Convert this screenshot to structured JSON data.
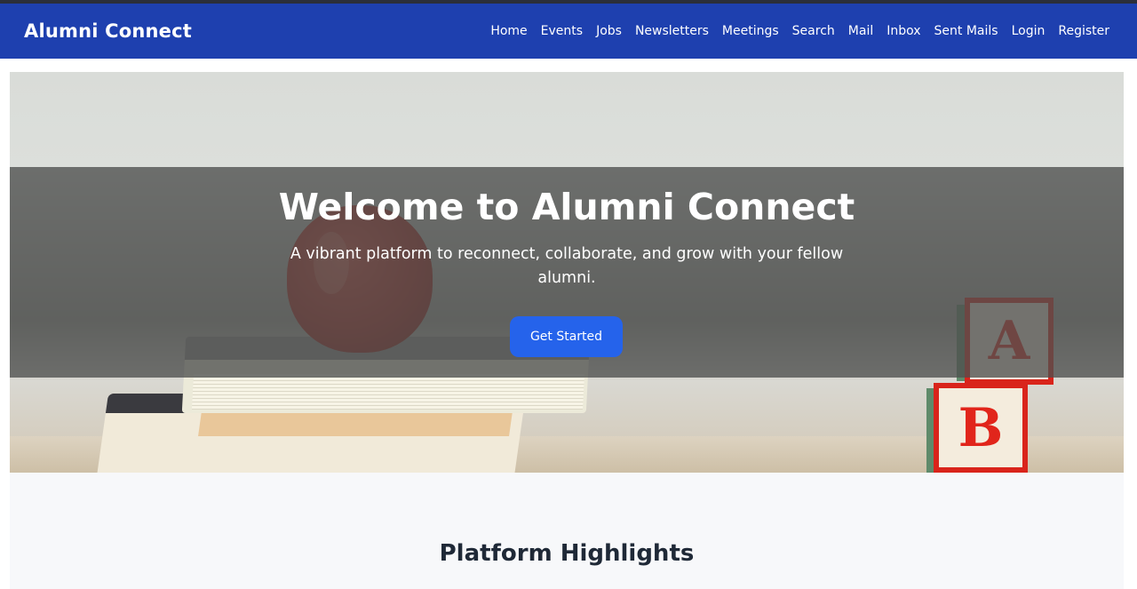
{
  "brand": {
    "name": "Alumni Connect"
  },
  "nav": {
    "items": [
      {
        "label": "Home"
      },
      {
        "label": "Events"
      },
      {
        "label": "Jobs"
      },
      {
        "label": "Newsletters"
      },
      {
        "label": "Meetings"
      },
      {
        "label": "Search"
      },
      {
        "label": "Mail"
      },
      {
        "label": "Inbox"
      },
      {
        "label": "Sent Mails"
      },
      {
        "label": "Login"
      },
      {
        "label": "Register"
      }
    ]
  },
  "hero": {
    "title": "Welcome to Alumni Connect",
    "subtitle": "A vibrant platform to reconnect, collaborate, and grow with your fellow alumni.",
    "cta_label": "Get Started",
    "block_a": "A",
    "block_b": "B"
  },
  "highlights": {
    "title": "Platform Highlights"
  },
  "colors": {
    "navbar": "#1e40af",
    "accent": "#2563eb",
    "section_bg": "#f7f8fa"
  }
}
